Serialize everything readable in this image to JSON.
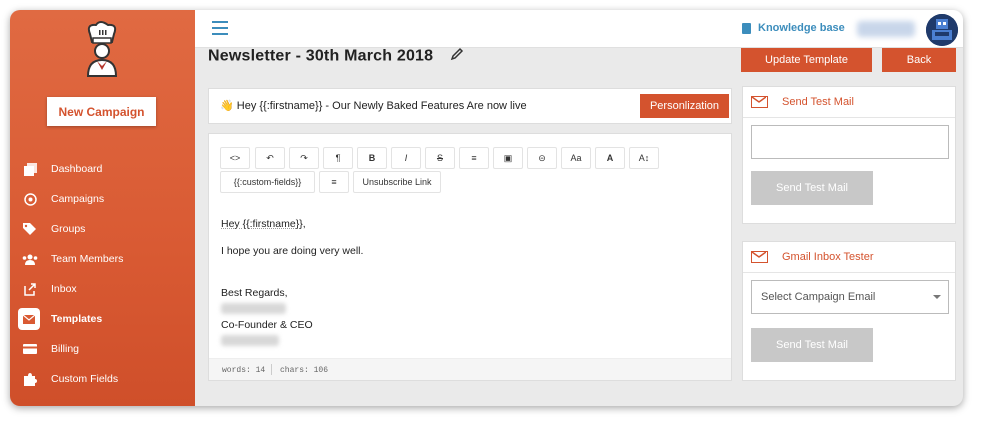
{
  "sidebar": {
    "new_campaign_label": "New Campaign",
    "items": [
      {
        "label": "Dashboard",
        "icon": "dashboard-icon"
      },
      {
        "label": "Campaigns",
        "icon": "target-icon"
      },
      {
        "label": "Groups",
        "icon": "tags-icon"
      },
      {
        "label": "Team Members",
        "icon": "users-icon"
      },
      {
        "label": "Inbox",
        "icon": "inbox-share-icon"
      },
      {
        "label": "Templates",
        "icon": "envelope-icon",
        "active": true
      },
      {
        "label": "Billing",
        "icon": "credit-card-icon"
      },
      {
        "label": "Custom Fields",
        "icon": "puzzle-icon"
      }
    ]
  },
  "topbar": {
    "knowledge_base_label": "Knowledge base"
  },
  "page": {
    "title": "Newsletter - 30th March 2018",
    "update_template_label": "Update Template",
    "back_label": "Back"
  },
  "subject": {
    "emoji": "👋",
    "text": "Hey {{:firstname}} - Our Newly Baked Features Are now live",
    "personalization_label": "Personlization"
  },
  "editor": {
    "toolbar": [
      "<>",
      "↶",
      "↷",
      "¶",
      "B",
      "I",
      "S",
      "≡",
      "▣",
      "⊝",
      "Aa",
      "A",
      "A↕"
    ],
    "custom_fields_label": "{{:custom-fields}}",
    "align_label": "≡",
    "unsubscribe_label": "Unsubscribe Link",
    "greeting": "Hey {{:firstname}},",
    "line1": "I hope you are doing very well.",
    "regards": "Best Regards,",
    "role": "Co-Founder & CEO",
    "words": "words: 14",
    "chars": "chars: 106"
  },
  "test_mail": {
    "title": "Send Test Mail",
    "input_value": "",
    "button_label": "Send Test Mail"
  },
  "gmail_tester": {
    "title": "Gmail Inbox Tester",
    "select_placeholder": "Select Campaign Email",
    "button_label": "Send Test Mail"
  },
  "colors": {
    "brand": "#d4532e",
    "link": "#3c8dbc",
    "disabled": "#c8c8c8"
  }
}
